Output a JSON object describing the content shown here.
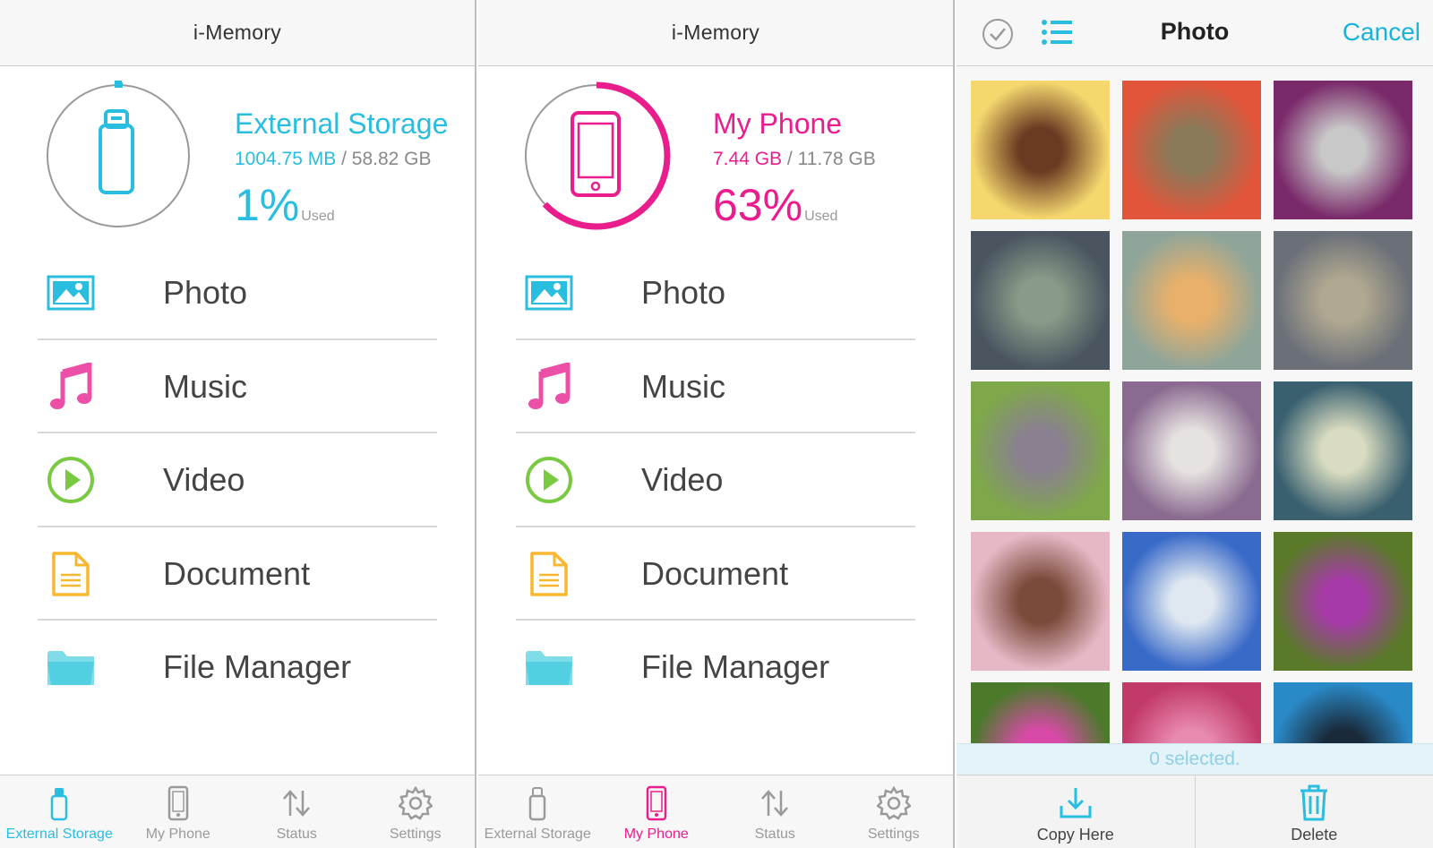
{
  "colors": {
    "cyan": "#29bde0",
    "magenta": "#e91e8c",
    "pink_icon": "#ec4fa6",
    "green_icon": "#7ac943",
    "orange_icon": "#f7b731",
    "folder_icon": "#5fd3e3",
    "gray_text": "#888888"
  },
  "app_title": "i-Memory",
  "panels": [
    {
      "title": "i-Memory",
      "storage": {
        "name": "External Storage",
        "used_amount": "1004.75 MB",
        "separator": " / ",
        "total_amount": "58.82 GB",
        "percent": "1%",
        "used_word": "Used",
        "used_fraction": 0.01,
        "color": "#29bde0",
        "icon": "usb-drive-icon"
      },
      "menu": [
        {
          "label": "Photo",
          "icon": "photo-icon"
        },
        {
          "label": "Music",
          "icon": "music-note-icon"
        },
        {
          "label": "Video",
          "icon": "play-circle-icon"
        },
        {
          "label": "Document",
          "icon": "document-icon"
        },
        {
          "label": "File Manager",
          "icon": "folder-icon"
        }
      ],
      "tabs": [
        {
          "label": "External Storage",
          "icon": "usb-drive-icon",
          "active": true
        },
        {
          "label": "My Phone",
          "icon": "phone-icon",
          "active": false
        },
        {
          "label": "Status",
          "icon": "transfer-arrows-icon",
          "active": false
        },
        {
          "label": "Settings",
          "icon": "gear-icon",
          "active": false
        }
      ]
    },
    {
      "title": "i-Memory",
      "storage": {
        "name": "My Phone",
        "used_amount": "7.44 GB",
        "separator": " / ",
        "total_amount": "11.78 GB",
        "percent": "63%",
        "used_word": "Used",
        "used_fraction": 0.63,
        "color": "#e91e8c",
        "icon": "phone-icon"
      },
      "menu": [
        {
          "label": "Photo",
          "icon": "photo-icon"
        },
        {
          "label": "Music",
          "icon": "music-note-icon"
        },
        {
          "label": "Video",
          "icon": "play-circle-icon"
        },
        {
          "label": "Document",
          "icon": "document-icon"
        },
        {
          "label": "File Manager",
          "icon": "folder-icon"
        }
      ],
      "tabs": [
        {
          "label": "External Storage",
          "icon": "usb-drive-icon",
          "active": false
        },
        {
          "label": "My Phone",
          "icon": "phone-icon",
          "active": true
        },
        {
          "label": "Status",
          "icon": "transfer-arrows-icon",
          "active": false
        },
        {
          "label": "Settings",
          "icon": "gear-icon",
          "active": false
        }
      ]
    }
  ],
  "photo_view": {
    "title": "Photo",
    "cancel_label": "Cancel",
    "selected_text": "0 selected.",
    "actions": [
      {
        "label": "Copy Here",
        "icon": "download-icon"
      },
      {
        "label": "Delete",
        "icon": "trash-icon"
      }
    ],
    "thumbnails": [
      {
        "subject": "yellow-flower-photo",
        "colors": [
          "#f5d76e",
          "#6b3a22"
        ]
      },
      {
        "subject": "apple-photo",
        "colors": [
          "#e2553a",
          "#8a7a5a"
        ]
      },
      {
        "subject": "flower-pot-photo",
        "colors": [
          "#7a2a6a",
          "#c8c8c8"
        ]
      },
      {
        "subject": "raindrops-photo",
        "colors": [
          "#4a5560",
          "#8a9a88"
        ]
      },
      {
        "subject": "sky-clouds-photo",
        "colors": [
          "#8fa59a",
          "#e8b06a"
        ]
      },
      {
        "subject": "branch-bud-photo",
        "colors": [
          "#6a6f78",
          "#b0a890"
        ]
      },
      {
        "subject": "pigeon-photo",
        "colors": [
          "#7fa84a",
          "#8a8090"
        ]
      },
      {
        "subject": "dandelion-photo",
        "colors": [
          "#8a6a90",
          "#e6e2e0"
        ]
      },
      {
        "subject": "dandelion-clock-photo",
        "colors": [
          "#3a6070",
          "#d9dcc0"
        ]
      },
      {
        "subject": "pink-blossoms-photo",
        "colors": [
          "#e6b8c6",
          "#7a4a3a"
        ]
      },
      {
        "subject": "tree-sky-photo",
        "colors": [
          "#3a6ac8",
          "#dfe8f0"
        ]
      },
      {
        "subject": "thistle-photo",
        "colors": [
          "#5a7a2a",
          "#a63aa8"
        ]
      },
      {
        "subject": "aster-photo",
        "colors": [
          "#4a7a2a",
          "#d94aa8"
        ]
      },
      {
        "subject": "pink-flower-photo",
        "colors": [
          "#c23a6a",
          "#e88ab0"
        ]
      },
      {
        "subject": "branches-sky-photo",
        "colors": [
          "#2a8ac8",
          "#1a2a3a"
        ]
      }
    ]
  }
}
